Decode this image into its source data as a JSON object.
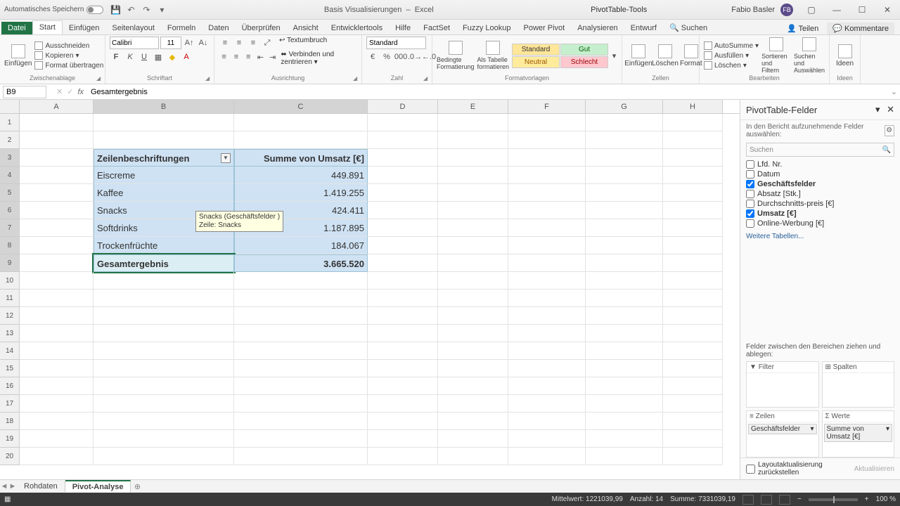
{
  "titlebar": {
    "autosave": "Automatisches Speichern",
    "doc": "Basis Visualisierungen",
    "app": "Excel",
    "tools": "PivotTable-Tools",
    "user": "Fabio Basler",
    "initials": "FB"
  },
  "tabs": {
    "file": "Datei",
    "start": "Start",
    "einf": "Einfügen",
    "layout": "Seitenlayout",
    "formeln": "Formeln",
    "daten": "Daten",
    "pruef": "Überprüfen",
    "ansicht": "Ansicht",
    "entw": "Entwicklertools",
    "hilfe": "Hilfe",
    "factset": "FactSet",
    "fuzzy": "Fuzzy Lookup",
    "powerpivot": "Power Pivot",
    "analyse": "Analysieren",
    "entwurf": "Entwurf",
    "suchen": "Suchen",
    "teilen": "Teilen",
    "kommentare": "Kommentare"
  },
  "ribbon": {
    "paste": "Einfügen",
    "cut": "Ausschneiden",
    "copy": "Kopieren",
    "brush": "Format übertragen",
    "g_clip": "Zwischenablage",
    "font": "Calibri",
    "size": "11",
    "g_font": "Schriftart",
    "wrap": "Textumbruch",
    "merge": "Verbinden und zentrieren",
    "g_align": "Ausrichtung",
    "numfmt": "Standard",
    "g_num": "Zahl",
    "condfmt": "Bedingte Formatierung",
    "astable": "Als Tabelle formatieren",
    "s_std": "Standard",
    "s_gut": "Gut",
    "s_neutral": "Neutral",
    "s_schlecht": "Schlecht",
    "g_styles": "Formatvorlagen",
    "insert": "Einfügen",
    "delete": "Löschen",
    "format": "Format",
    "g_cells": "Zellen",
    "autosum": "AutoSumme",
    "fill": "Ausfüllen",
    "clear": "Löschen",
    "sort": "Sortieren und Filtern",
    "find": "Suchen und Auswählen",
    "g_edit": "Bearbeiten",
    "ideas": "Ideen",
    "g_ideas": "Ideen"
  },
  "fbar": {
    "cell": "B9",
    "formula": "Gesamtergebnis"
  },
  "cols": {
    "A": "A",
    "B": "B",
    "C": "C",
    "D": "D",
    "E": "E",
    "F": "F",
    "G": "G",
    "H": "H"
  },
  "pivot": {
    "hdr_row": "Zeilenbeschriftungen",
    "hdr_val": "Summe von Umsatz [€]",
    "rows": [
      {
        "label": "Eiscreme",
        "val": "449.891"
      },
      {
        "label": "Kaffee",
        "val": "1.419.255"
      },
      {
        "label": "Snacks",
        "val": "424.411"
      },
      {
        "label": "Softdrinks",
        "val": "1.187.895"
      },
      {
        "label": "Trockenfrüchte",
        "val": "184.067"
      }
    ],
    "total_lbl": "Gesamtergebnis",
    "total_val": "3.665.520"
  },
  "tooltip": {
    "l1": "Snacks (Geschäftsfelder )",
    "l2": "Zeile: Snacks"
  },
  "pane": {
    "title": "PivotTable-Felder",
    "sub": "In den Bericht aufzunehmende Felder auswählen:",
    "search": "Suchen",
    "fields": [
      {
        "label": "Lfd. Nr.",
        "chk": false
      },
      {
        "label": "Datum",
        "chk": false
      },
      {
        "label": "Geschäftsfelder",
        "chk": true
      },
      {
        "label": "Absatz  [Stk.]",
        "chk": false
      },
      {
        "label": "Durchschnitts-preis [€]",
        "chk": false
      },
      {
        "label": "Umsatz [€]",
        "chk": true
      },
      {
        "label": "Online-Werbung [€]",
        "chk": false
      }
    ],
    "more": "Weitere Tabellen...",
    "areahint": "Felder zwischen den Bereichen ziehen und ablegen:",
    "a_filter": "Filter",
    "a_cols": "Spalten",
    "a_rows": "Zeilen",
    "a_vals": "Werte",
    "row_item": "Geschäftsfelder",
    "val_item": "Summe von Umsatz [€]",
    "defer": "Layoutaktualisierung zurückstellen",
    "update": "Aktualisieren"
  },
  "sheets": {
    "s1": "Rohdaten",
    "s2": "Pivot-Analyse"
  },
  "status": {
    "mw": "Mittelwert: 1221039,99",
    "cnt": "Anzahl: 14",
    "sum": "Summe: 7331039,19",
    "zoom": "100 %"
  }
}
